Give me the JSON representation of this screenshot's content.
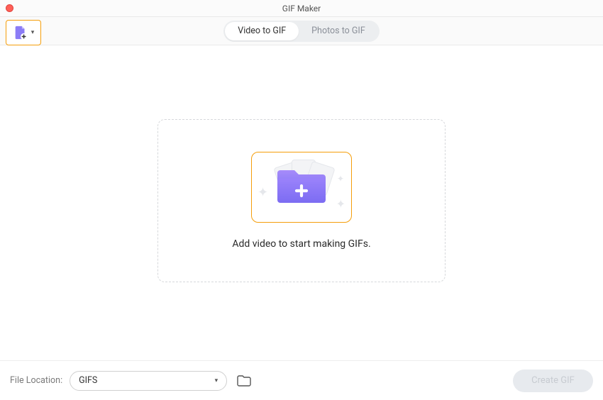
{
  "window": {
    "title": "GIF Maker"
  },
  "toolbar": {
    "modeA": "Video to GIF",
    "modeB": "Photos to GIF"
  },
  "dropzone": {
    "prompt": "Add video to start making GIFs."
  },
  "footer": {
    "locationLabel": "File Location:",
    "locationValue": "GIFS",
    "createLabel": "Create GIF"
  }
}
